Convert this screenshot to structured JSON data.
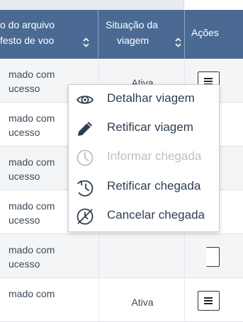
{
  "table": {
    "headers": {
      "file_line1": "o do arquivo",
      "file_line2": "festo de voo",
      "status_line1": "Situação da",
      "status_line2": "viagem",
      "actions": "Ações"
    },
    "rows": [
      {
        "file_line1": "mado com",
        "file_line2": "ucesso",
        "status": "Ativa"
      },
      {
        "file_line1": "mado com",
        "file_line2": "ucesso",
        "status": ""
      },
      {
        "file_line1": "mado com",
        "file_line2": "ucesso",
        "status": ""
      },
      {
        "file_line1": "mado com",
        "file_line2": "ucesso",
        "status": ""
      },
      {
        "file_line1": "mado com",
        "file_line2": "ucesso",
        "status": ""
      },
      {
        "file_line1": "mado com",
        "file_line2": "",
        "status": "Ativa"
      }
    ]
  },
  "menu": {
    "items": [
      {
        "label": "Detalhar viagem",
        "icon": "eye-icon",
        "enabled": true
      },
      {
        "label": "Retificar viagem",
        "icon": "pencil-icon",
        "enabled": true
      },
      {
        "label": "Informar chegada",
        "icon": "clock-icon",
        "enabled": false
      },
      {
        "label": "Retificar chegada",
        "icon": "clock-undo-icon",
        "enabled": true
      },
      {
        "label": "Cancelar chegada",
        "icon": "clock-cancel-icon",
        "enabled": true
      }
    ]
  },
  "colors": {
    "header_bg": "#4a6a94",
    "row_odd_bg": "#f4f5f7",
    "text": "#3c4a5a",
    "menu_text": "#2f3f52",
    "disabled_text": "#b9c0c8"
  }
}
